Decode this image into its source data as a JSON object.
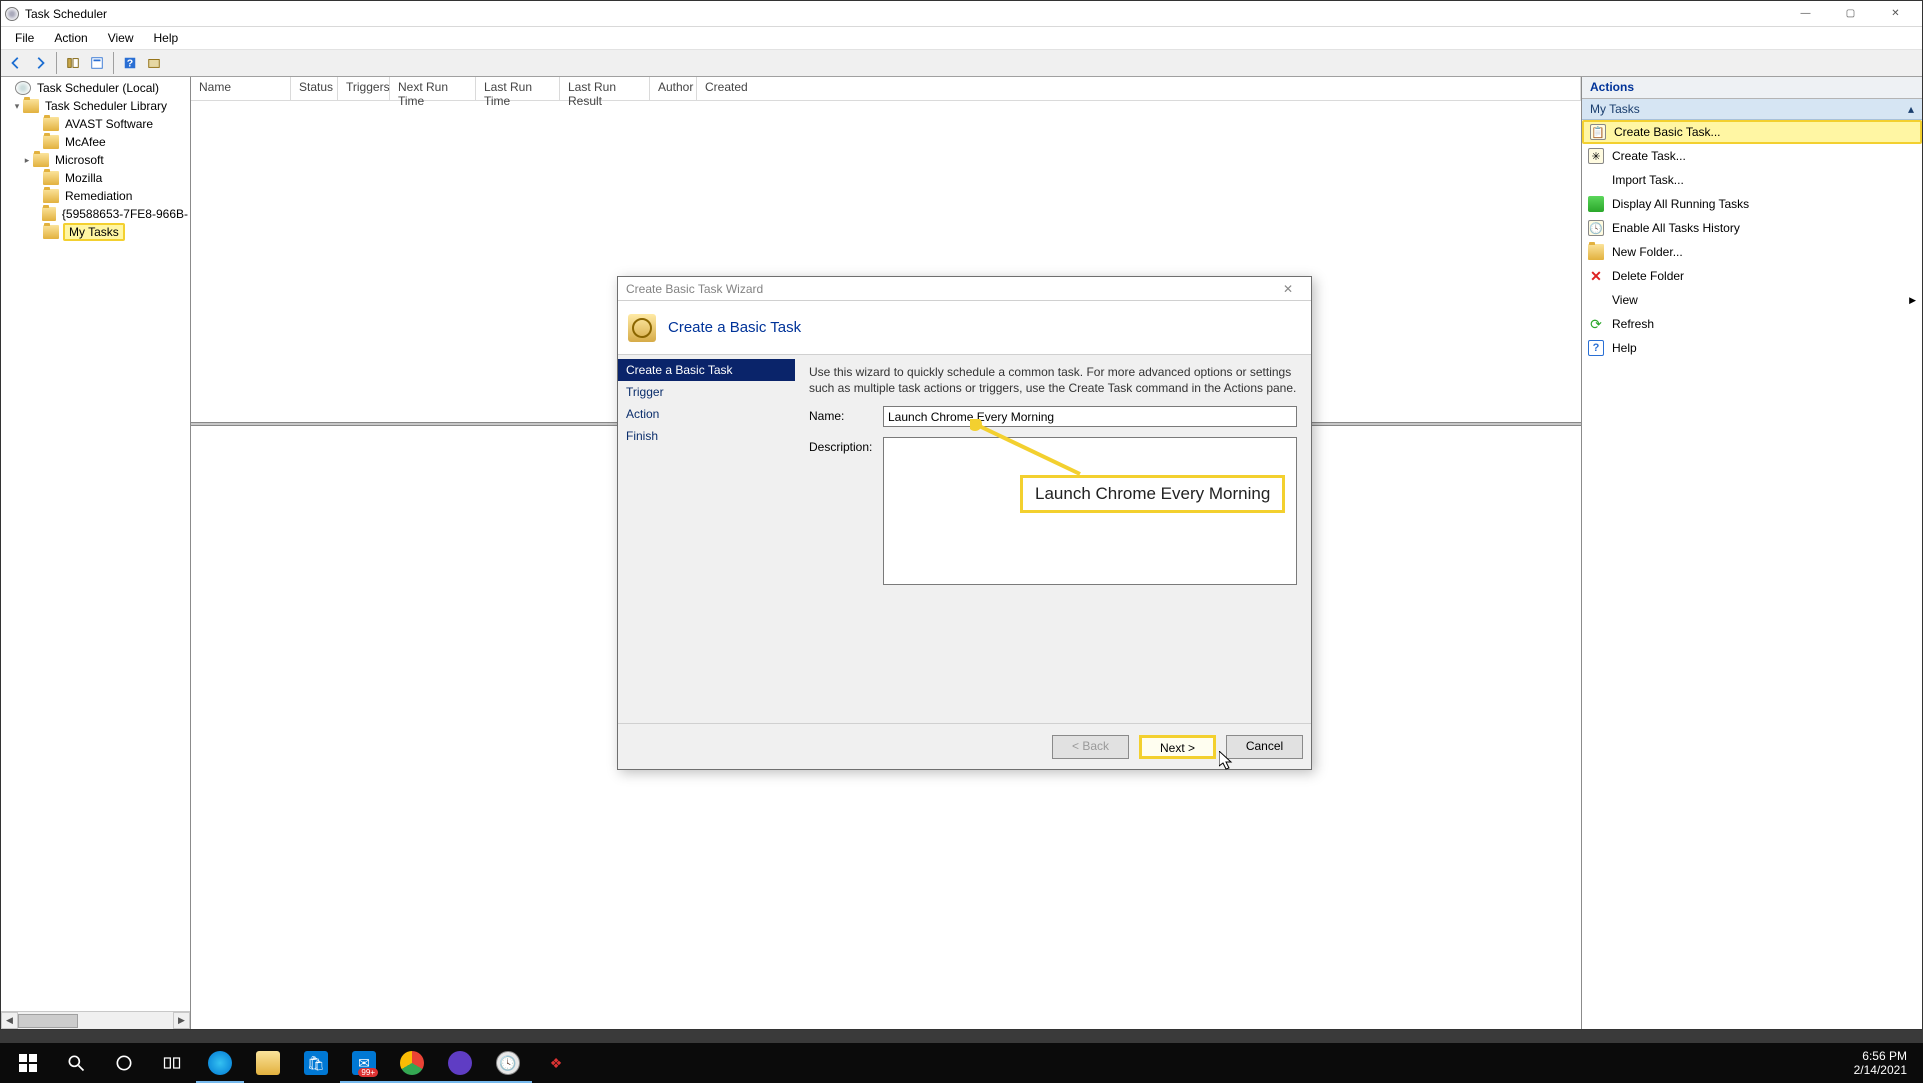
{
  "window": {
    "title": "Task Scheduler",
    "min": "—",
    "max": "▢",
    "close": "✕"
  },
  "menu": [
    "File",
    "Action",
    "View",
    "Help"
  ],
  "tree": {
    "root": "Task Scheduler (Local)",
    "library": "Task Scheduler Library",
    "items": [
      "AVAST Software",
      "McAfee",
      "Microsoft",
      "Mozilla",
      "Remediation",
      "{59588653-7FE8-966B-"
    ],
    "selected": "My Tasks"
  },
  "columns": [
    "Name",
    "Status",
    "Triggers",
    "Next Run Time",
    "Last Run Time",
    "Last Run Result",
    "Author",
    "Created"
  ],
  "actions": {
    "title": "Actions",
    "section": "My Tasks",
    "items": [
      "Create Basic Task...",
      "Create Task...",
      "Import Task...",
      "Display All Running Tasks",
      "Enable All Tasks History",
      "New Folder...",
      "Delete Folder",
      "View",
      "Refresh",
      "Help"
    ]
  },
  "wizard": {
    "title": "Create Basic Task Wizard",
    "heading": "Create a Basic Task",
    "steps": [
      "Create a Basic Task",
      "Trigger",
      "Action",
      "Finish"
    ],
    "instr": "Use this wizard to quickly schedule a common task.  For more advanced options or settings such as multiple task actions or triggers, use the Create Task command in the Actions pane.",
    "name_label": "Name:",
    "name_value": "Launch Chrome Every Morning",
    "desc_label": "Description:",
    "callout": "Launch Chrome Every Morning",
    "back": "< Back",
    "next": "Next >",
    "cancel": "Cancel"
  },
  "taskbar": {
    "time": "6:56 PM",
    "date": "2/14/2021"
  }
}
